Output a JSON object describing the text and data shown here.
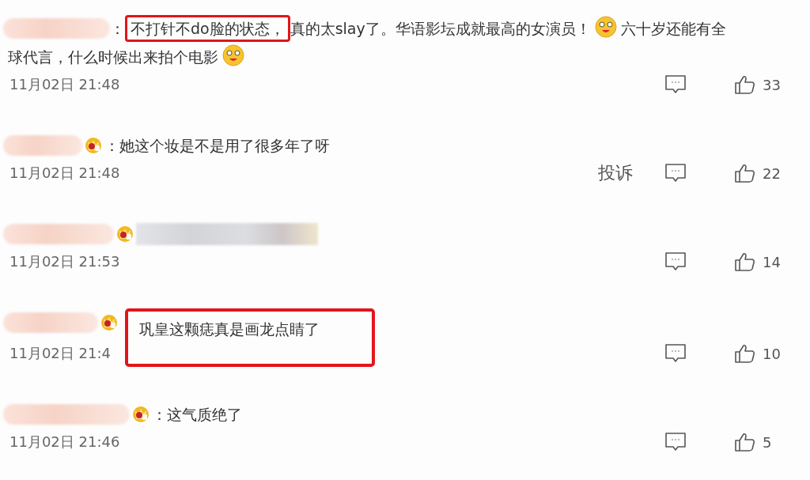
{
  "comments": [
    {
      "badge": false,
      "lines": [
        [
          {
            "kind": "text",
            "text": "："
          },
          {
            "kind": "highlight",
            "text": "不打针不do脸的状态，"
          },
          {
            "kind": "text",
            "text": "真的太slay了。华语影坛成就最高的女演员！"
          },
          {
            "kind": "emoji"
          },
          {
            "kind": "text",
            "text": "六十岁还能有全"
          }
        ],
        [
          {
            "kind": "text",
            "text": "球代言，什么时候出来拍个电影"
          },
          {
            "kind": "emoji"
          }
        ]
      ],
      "time": "11月02日 21:48",
      "likes": "33"
    },
    {
      "badge": true,
      "lines": [
        [
          {
            "kind": "text",
            "text": "：她这个妆是不是用了很多年了呀"
          }
        ]
      ],
      "time": "11月02日 21:48",
      "report": "投诉",
      "likes": "22"
    },
    {
      "badge": true,
      "lines": [
        [
          {
            "kind": "redacted"
          }
        ]
      ],
      "time": "11月02日 21:53",
      "likes": "14"
    },
    {
      "badge": true,
      "lines": [
        [
          {
            "kind": "boxed",
            "text": "巩皇这颗痣真是画龙点睛了"
          }
        ]
      ],
      "time": "11月02日 21:4",
      "likes": "10"
    },
    {
      "badge": true,
      "lines": [
        [
          {
            "kind": "text",
            "text": "：这气质绝了"
          }
        ]
      ],
      "time": "11月02日 21:46",
      "likes": "5"
    }
  ]
}
